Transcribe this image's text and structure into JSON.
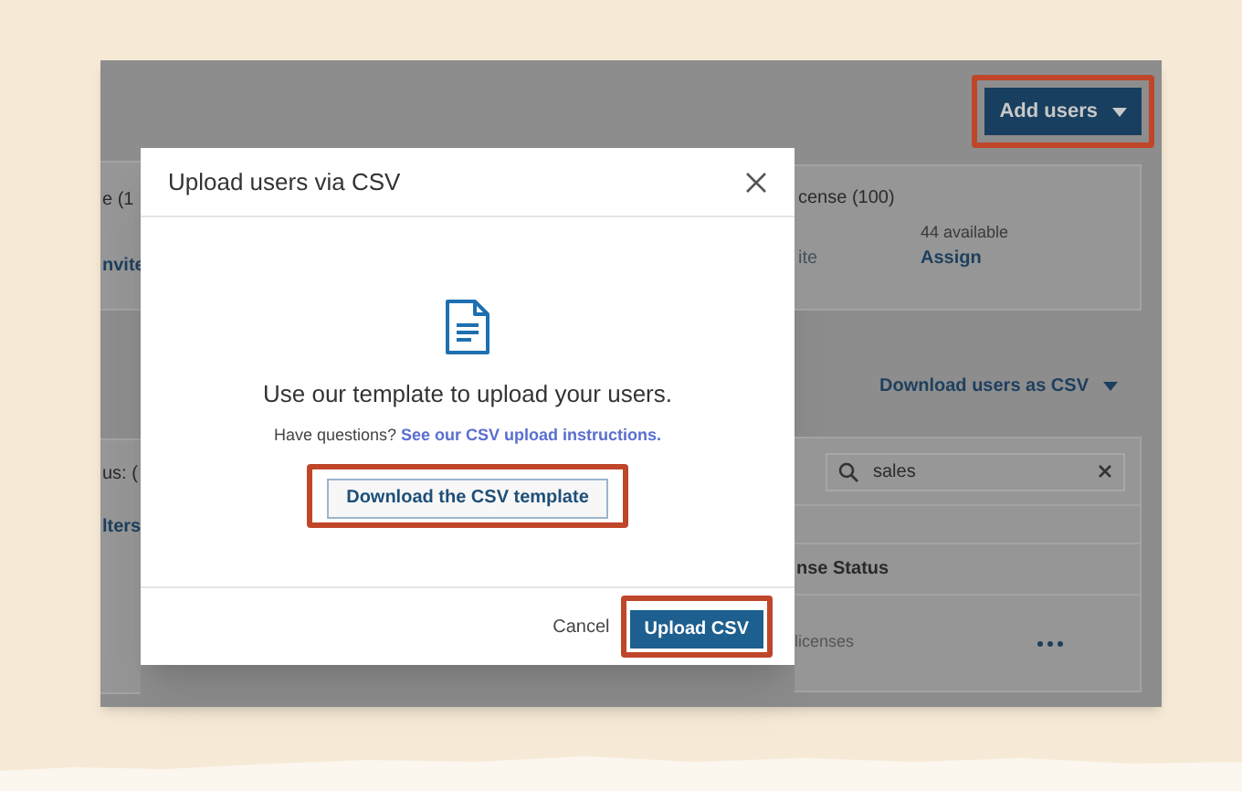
{
  "page_behind": {
    "add_users_button": {
      "label": "Add users",
      "highlighted": true
    },
    "card_left": {
      "title": "e (1",
      "link": "nvite"
    },
    "card_right": {
      "title": "cense (100)",
      "link_faded": "ite",
      "available": "44 available",
      "link": "Assign"
    },
    "download_menu": "Download users as CSV",
    "table": {
      "status_label": "us: (",
      "filters_link": "lters",
      "search": {
        "value": "sales"
      },
      "column_header": "nse Status",
      "row_cell": "licenses"
    }
  },
  "dialog": {
    "title": "Upload users via CSV",
    "heading": "Use our template to upload your users.",
    "help": {
      "text": "Have questions?",
      "link": "See our CSV upload instructions."
    },
    "template_button": {
      "label": "Download the CSV template",
      "highlighted": true
    },
    "footer": {
      "cancel": "Cancel",
      "upload_button": {
        "label": "Upload CSV",
        "highlighted": true
      }
    }
  }
}
